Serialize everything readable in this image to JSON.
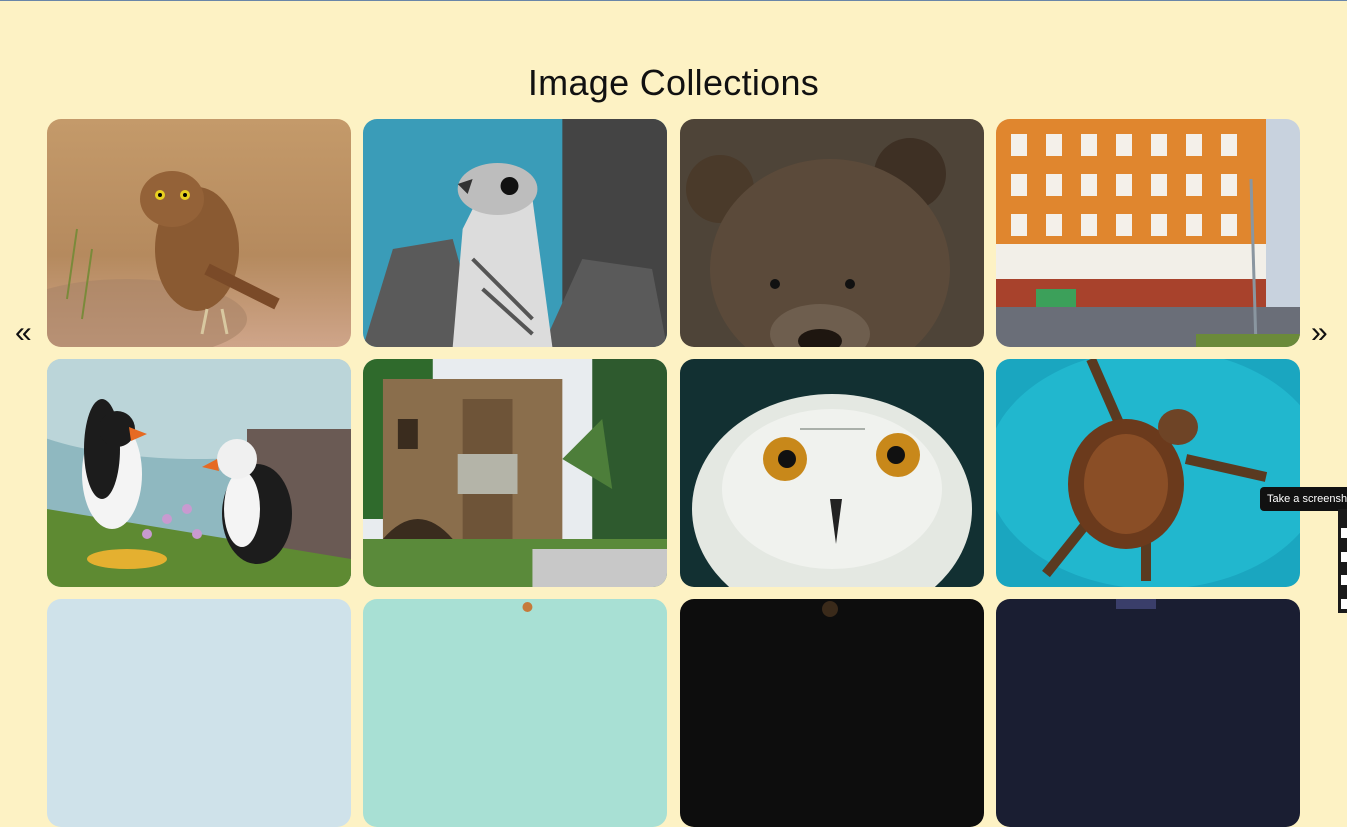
{
  "page": {
    "title": "Image Collections"
  },
  "nav": {
    "prev_label": "«",
    "next_label": "»"
  },
  "tooltip": {
    "text": "Take a screenshot"
  },
  "gallery": {
    "images": [
      {
        "subject": "burrowing owl in grass"
      },
      {
        "subject": "falcon with spread wings"
      },
      {
        "subject": "brown bear face"
      },
      {
        "subject": "orange city building"
      },
      {
        "subject": "puffins on cliff"
      },
      {
        "subject": "old stone ruin building"
      },
      {
        "subject": "snowy owl face"
      },
      {
        "subject": "sea turtle swimming"
      },
      {
        "subject": "partial image row 3 col 1"
      },
      {
        "subject": "partial image row 3 col 2"
      },
      {
        "subject": "partial image row 3 col 3"
      },
      {
        "subject": "partial image row 3 col 4"
      }
    ]
  }
}
